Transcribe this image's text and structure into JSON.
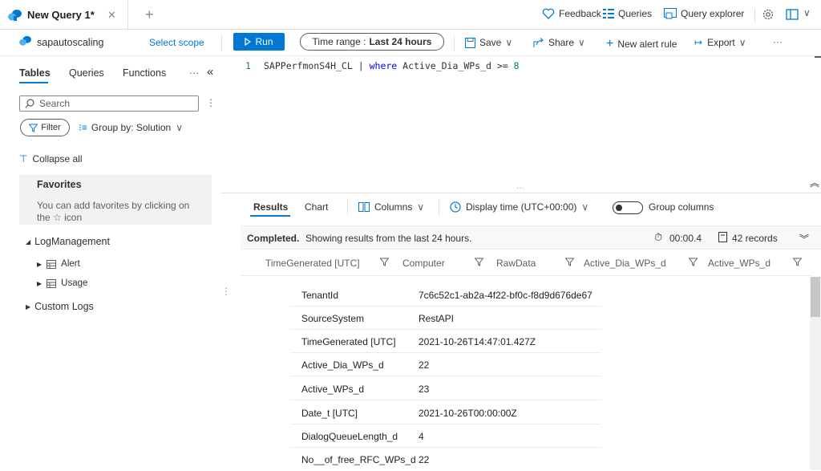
{
  "tab": {
    "title": "New Query 1*"
  },
  "topbar": {
    "feedback": "Feedback",
    "queries": "Queries",
    "query_explorer": "Query explorer"
  },
  "scope": {
    "name": "sapautoscaling",
    "select_scope": "Select scope"
  },
  "toolbar": {
    "run": "Run",
    "time_range_label": "Time range :",
    "time_range_value": "Last 24 hours",
    "save": "Save",
    "share": "Share",
    "new_alert_rule": "New alert rule",
    "export": "Export",
    "more": "···"
  },
  "left_tabs": {
    "tables": "Tables",
    "queries": "Queries",
    "functions": "Functions",
    "more": "···"
  },
  "search": {
    "placeholder": "Search"
  },
  "filter": {
    "label": "Filter"
  },
  "group_by": {
    "label": "Group by: Solution"
  },
  "collapse_all": "Collapse all",
  "favorites": {
    "title": "Favorites",
    "hint": "You can add favorites by clicking on the ☆ icon"
  },
  "tree": {
    "log_management": "LogManagement",
    "alert": "Alert",
    "usage": "Usage",
    "custom_logs": "Custom Logs"
  },
  "editor": {
    "line_number": "1",
    "table": "SAPPerfmonS4H_CL",
    "pipe": "|",
    "keyword": "where",
    "condition": "Active_Dia_WPs_d >=",
    "value": "8"
  },
  "results_tabs": {
    "results": "Results",
    "chart": "Chart",
    "columns": "Columns",
    "display_time": "Display time (UTC+00:00)",
    "group_columns": "Group columns"
  },
  "status": {
    "completed": "Completed.",
    "message": "Showing results from the last 24 hours.",
    "duration": "00:00.4",
    "records": "42 records"
  },
  "columns": [
    "TimeGenerated [UTC]",
    "Computer",
    "RawData",
    "Active_Dia_WPs_d",
    "Active_WPs_d"
  ],
  "detail_rows": [
    {
      "key": "TenantId",
      "value": "7c6c52c1-ab2a-4f22-bf0c-f8d9d676de67"
    },
    {
      "key": "SourceSystem",
      "value": "RestAPI"
    },
    {
      "key": "TimeGenerated [UTC]",
      "value": "2021-10-26T14:47:01.427Z"
    },
    {
      "key": "Active_Dia_WPs_d",
      "value": "22"
    },
    {
      "key": "Active_WPs_d",
      "value": "23"
    },
    {
      "key": "Date_t [UTC]",
      "value": "2021-10-26T00:00:00Z"
    },
    {
      "key": "DialogQueueLength_d",
      "value": "4"
    },
    {
      "key": "No__of_free_RFC_WPs_d",
      "value": "22"
    }
  ]
}
